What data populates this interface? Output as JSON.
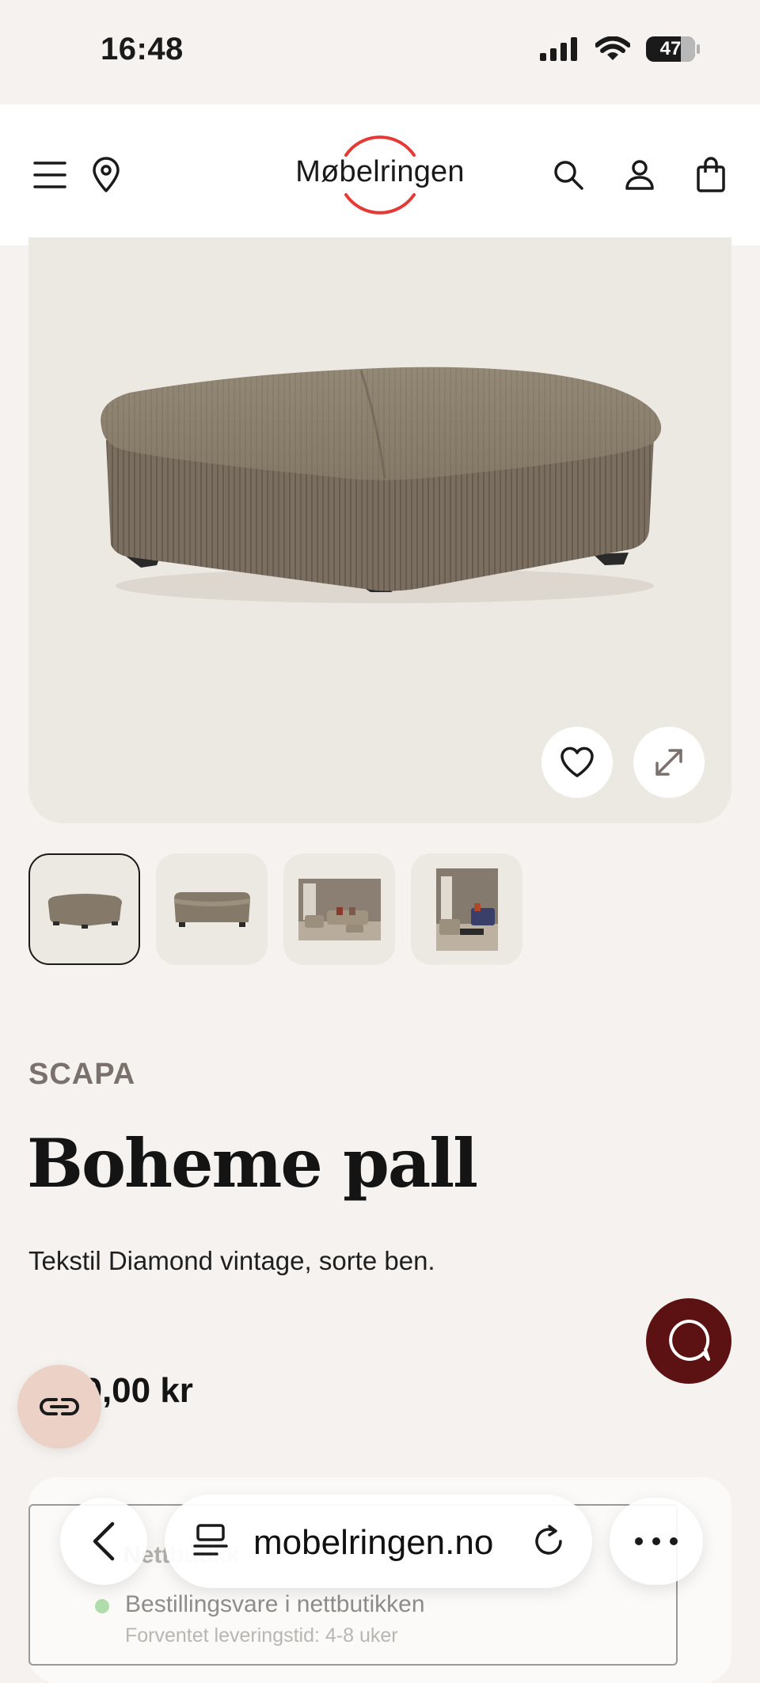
{
  "status_bar": {
    "time": "16:48",
    "battery": "47"
  },
  "header": {
    "logo_text": "Møbelringen",
    "icons": [
      "menu-icon",
      "location-pin-icon",
      "search-icon",
      "account-icon",
      "shopping-bag-icon"
    ]
  },
  "product": {
    "brand": "SCAPA",
    "title": "Boheme pall",
    "description": "Tekstil Diamond vintage, sorte ben.",
    "price": "…99,00 kr",
    "thumbnails": 4
  },
  "availability": {
    "section_label": "Nettbutikk",
    "status": "Bestillingsvare i nettbutikken",
    "delivery": "Forventet leveringstid: 4-8 uker"
  },
  "browser": {
    "url": "mobelringen.no"
  },
  "colors": {
    "accent_red": "#e53935",
    "chat_button": "#5c1212",
    "page_bg": "#f5f2ef",
    "hero_bg": "#ece8e2"
  }
}
